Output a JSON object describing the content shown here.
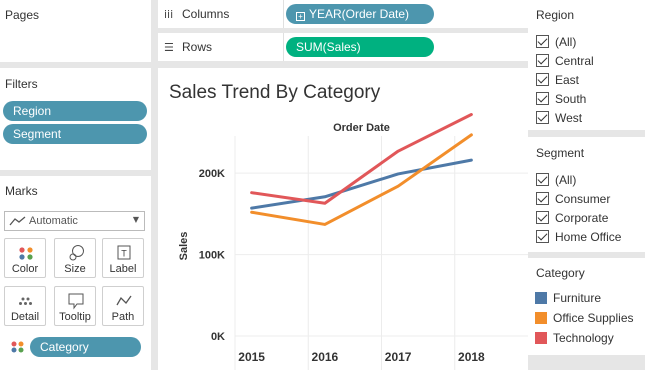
{
  "pages": {
    "title": "Pages"
  },
  "filters": {
    "title": "Filters",
    "pills": [
      "Region",
      "Segment"
    ]
  },
  "marks": {
    "title": "Marks",
    "mark_type": "Automatic",
    "buttons": [
      "Color",
      "Size",
      "Label",
      "Detail",
      "Tooltip",
      "Path"
    ],
    "color_pill": "Category"
  },
  "shelves": {
    "columns_label": "Columns",
    "columns_pill": "YEAR(Order Date)",
    "rows_label": "Rows",
    "rows_pill": "SUM(Sales)"
  },
  "sheet": {
    "title": "Sales Trend By Category"
  },
  "region_filter": {
    "title": "Region",
    "items": [
      "(All)",
      "Central",
      "East",
      "South",
      "West"
    ]
  },
  "segment_filter": {
    "title": "Segment",
    "items": [
      "(All)",
      "Consumer",
      "Corporate",
      "Home Office"
    ]
  },
  "category_legend": {
    "title": "Category",
    "items": [
      {
        "label": "Furniture",
        "color": "#4e79a7"
      },
      {
        "label": "Office Supplies",
        "color": "#f28e2b"
      },
      {
        "label": "Technology",
        "color": "#e15759"
      }
    ]
  },
  "chart_data": {
    "type": "line",
    "title": "Order Date",
    "xlabel": "",
    "ylabel": "Sales",
    "categories": [
      "2015",
      "2016",
      "2017",
      "2018"
    ],
    "yticks": [
      "0K",
      "100K",
      "200K"
    ],
    "ylim": [
      0,
      280000
    ],
    "grid": true,
    "series": [
      {
        "name": "Furniture",
        "color": "#4e79a7",
        "values": [
          157000,
          171000,
          199000,
          216000
        ]
      },
      {
        "name": "Office Supplies",
        "color": "#f28e2b",
        "values": [
          152000,
          137000,
          184000,
          247000
        ]
      },
      {
        "name": "Technology",
        "color": "#e15759",
        "values": [
          176000,
          163000,
          227000,
          272000
        ]
      }
    ]
  }
}
